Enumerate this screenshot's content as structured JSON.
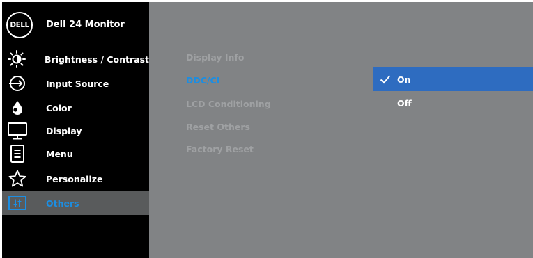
{
  "header": {
    "logo_text": "DELL",
    "title": "Dell 24 Monitor"
  },
  "sidebar": {
    "items": [
      {
        "label": "Brightness / Contrast",
        "icon": "brightness-icon"
      },
      {
        "label": "Input Source",
        "icon": "input-source-icon"
      },
      {
        "label": "Color",
        "icon": "color-icon"
      },
      {
        "label": "Display",
        "icon": "display-icon"
      },
      {
        "label": "Menu",
        "icon": "menu-icon"
      },
      {
        "label": "Personalize",
        "icon": "star-icon"
      },
      {
        "label": "Others",
        "icon": "others-icon",
        "active": true
      }
    ]
  },
  "submenu": {
    "items": [
      {
        "label": "Display Info"
      },
      {
        "label": "DDC/CI",
        "active": true
      },
      {
        "label": "LCD Conditioning"
      },
      {
        "label": "Reset Others"
      },
      {
        "label": "Factory Reset"
      }
    ]
  },
  "options": {
    "items": [
      {
        "label": "On",
        "selected": true
      },
      {
        "label": "Off",
        "selected": false
      }
    ]
  },
  "colors": {
    "sidebar_bg": "#000000",
    "main_bg": "#818385",
    "accent_blue": "#1c8ee2",
    "selected_bg": "#2e6cc0",
    "active_row_bg": "#595b5c"
  }
}
